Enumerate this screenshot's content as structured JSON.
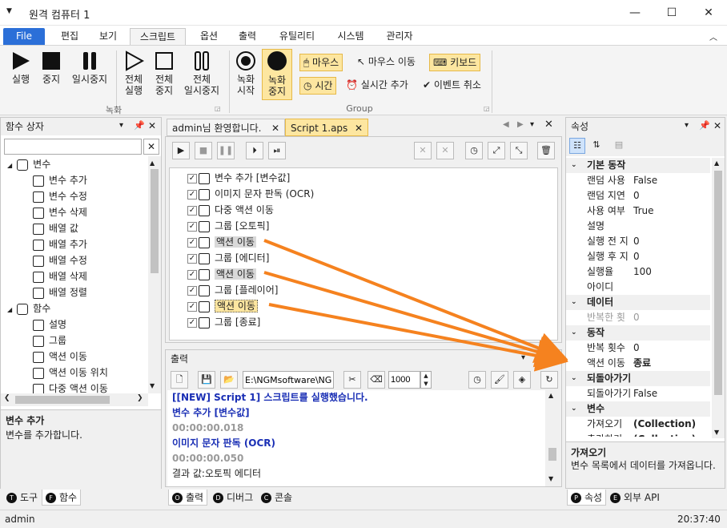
{
  "window": {
    "title": "원격 컴퓨터 1"
  },
  "menu": {
    "items": [
      "File",
      "편집",
      "보기",
      "스크립트",
      "옵션",
      "출력",
      "유틸리티",
      "시스템",
      "관리자"
    ]
  },
  "ribbon": {
    "run": "실행",
    "stop": "중지",
    "pause": "일시중지",
    "run_all": "전체\n실행",
    "stop_all": "전체\n중지",
    "pause_all": "전체\n일시중지",
    "group1": "녹화",
    "rec_start": "녹화\n시작",
    "rec_stop": "녹화\n중지",
    "mouse": "마우스",
    "mouse_move": "마우스 이동",
    "keyboard": "키보드",
    "time": "시간",
    "realtime_add": "실시간 추가",
    "event_cancel": "이벤트 취소",
    "group2": "Group"
  },
  "left_panel": {
    "title": "함수 상자",
    "tree": [
      {
        "label": "변수",
        "level": 0,
        "icon": "variable-icon",
        "expander": "◢"
      },
      {
        "label": "변수 추가",
        "level": 1,
        "icon": "cube-add-icon"
      },
      {
        "label": "변수 수정",
        "level": 1,
        "icon": "cube-edit-icon"
      },
      {
        "label": "변수 삭제",
        "level": 1,
        "icon": "cube-delete-icon"
      },
      {
        "label": "배열 값",
        "level": 1,
        "icon": "array-value-icon"
      },
      {
        "label": "배열 추가",
        "level": 1,
        "icon": "array-add-icon"
      },
      {
        "label": "배열 수정",
        "level": 1,
        "icon": "array-edit-icon"
      },
      {
        "label": "배열 삭제",
        "level": 1,
        "icon": "array-delete-icon"
      },
      {
        "label": "배열 정렬",
        "level": 1,
        "icon": "array-sort-icon"
      },
      {
        "label": "함수",
        "level": 0,
        "icon": "function-icon",
        "expander": "◢"
      },
      {
        "label": "설명",
        "level": 1,
        "icon": "comment-icon"
      },
      {
        "label": "그룹",
        "level": 1,
        "icon": "group-icon"
      },
      {
        "label": "액션 이동",
        "level": 1,
        "icon": "action-move-icon"
      },
      {
        "label": "액션 이동 위치",
        "level": 1,
        "icon": "action-position-icon"
      },
      {
        "label": "다중 액션 이동",
        "level": 1,
        "icon": "multi-action-icon"
      }
    ],
    "desc_title": "변수 추가",
    "desc_text": "변수를 추가합니다.",
    "tabs": [
      "도구",
      "함수"
    ]
  },
  "doc_tabs": [
    "admin님 환영합니다.",
    "Script 1.aps"
  ],
  "script": {
    "rows": [
      {
        "label": "변수 추가 [변수값]",
        "icon": "cube-add-icon",
        "checked": true,
        "highlight": false
      },
      {
        "label": "이미지 문자 판독 (OCR)",
        "icon": "ocr-icon",
        "checked": true,
        "highlight": false
      },
      {
        "label": "다중 액션 이동",
        "icon": "multi-action-icon",
        "checked": true,
        "highlight": false
      },
      {
        "label": "그룹 [오토픽]",
        "icon": "group-icon",
        "checked": true,
        "highlight": false
      },
      {
        "label": "액션 이동",
        "icon": "action-move-icon",
        "checked": true,
        "highlight": "gray"
      },
      {
        "label": "그룹 [에디터]",
        "icon": "group-icon",
        "checked": true,
        "highlight": false
      },
      {
        "label": "액션 이동",
        "icon": "action-move-icon",
        "checked": true,
        "highlight": "gray"
      },
      {
        "label": "그룹 [플레이어]",
        "icon": "group-icon",
        "checked": true,
        "highlight": false
      },
      {
        "label": "액션 이동",
        "icon": "action-move-icon",
        "checked": true,
        "highlight": "yellow"
      },
      {
        "label": "그룹 [종료]",
        "icon": "group-icon",
        "checked": true,
        "highlight": false
      }
    ]
  },
  "output": {
    "title": "출력",
    "path": "E:\\NGMsoftware\\NG",
    "number": "1000",
    "lines": [
      {
        "text": "[[NEW] Script 1] 스크립트를 실행했습니다.",
        "color": "#1a2fb5",
        "bold": true
      },
      {
        "text": "변수 추가 [변수값]",
        "color": "#1a2fb5",
        "bold": true
      },
      {
        "text": "00:00:00.018",
        "color": "#9a9a9a",
        "bold": true
      },
      {
        "text": "이미지 문자 판독 (OCR)",
        "color": "#1a2fb5",
        "bold": true
      },
      {
        "text": "00:00:00.050",
        "color": "#9a9a9a",
        "bold": true
      },
      {
        "text": "결과 값:오토픽 에디터",
        "color": "#222222",
        "bold": false
      }
    ],
    "tabs": [
      "출력",
      "디버그",
      "콘솔"
    ]
  },
  "props": {
    "title": "속성",
    "cat1": "기본 동작",
    "rows1": [
      [
        "랜덤 사용",
        "False"
      ],
      [
        "랜덤 지연",
        "0"
      ],
      [
        "사용 여부",
        "True"
      ],
      [
        "설명",
        ""
      ],
      [
        "실행 전 지",
        "0"
      ],
      [
        "실행 후 지",
        "0"
      ],
      [
        "실행율",
        "100"
      ],
      [
        "아이디",
        ""
      ]
    ],
    "cat2": "데이터",
    "rows2": [
      [
        "반복한 횟",
        "0"
      ]
    ],
    "cat3": "동작",
    "rows3": [
      [
        "반복 횟수",
        "0"
      ],
      [
        "액션 이동",
        "종료"
      ]
    ],
    "cat4": "되돌아가기",
    "rows4": [
      [
        "되돌아가기",
        "False"
      ]
    ],
    "cat5": "변수",
    "rows5": [
      [
        "가져오기",
        "(Collection)"
      ],
      [
        "추가하기",
        "(Collection)"
      ]
    ],
    "desc_title": "가져오기",
    "desc_text": "변수 목록에서 데이터를 가져옵니다.",
    "tabs": [
      "속성",
      "외부 API"
    ]
  },
  "status": {
    "user": "admin",
    "time": "20:37:40"
  },
  "colors": {
    "accent": "#2b6fd8",
    "arrow": "#f5821f",
    "highlight": "#fde6a0"
  }
}
